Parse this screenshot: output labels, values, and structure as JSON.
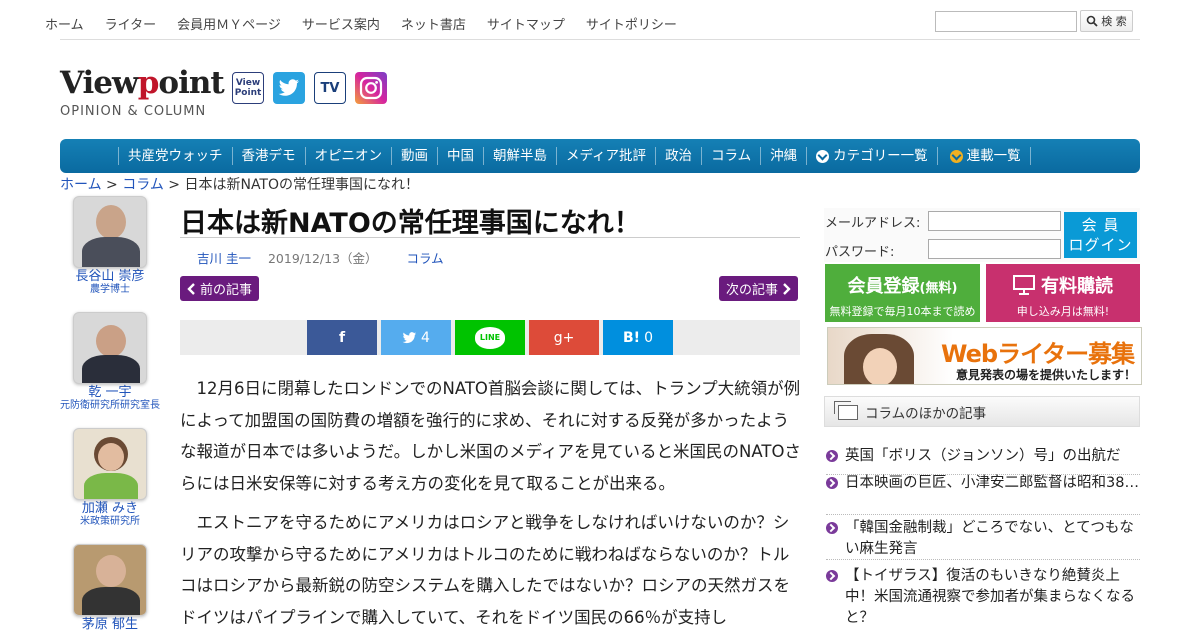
{
  "topnav": {
    "links": [
      "ホーム",
      "ライター",
      "会員用ＭＹページ",
      "サービス案内",
      "ネット書店",
      "サイトマップ",
      "サイトポリシー"
    ],
    "search_button": "検 索"
  },
  "logo": {
    "main_a": "View",
    "main_p": "p",
    "main_b": "oint",
    "sub": "OPINION & COLUMN"
  },
  "social": [
    {
      "name": "viewpoint-facebook",
      "label": "View Point",
      "color": "#2c3e7a"
    },
    {
      "name": "twitter",
      "label": "",
      "color": "#2aa3e0"
    },
    {
      "name": "tv-facebook",
      "label": "TV",
      "color": "#1a3f7a"
    },
    {
      "name": "instagram",
      "label": "",
      "color": "#c13584"
    }
  ],
  "catnav": {
    "items": [
      "共産党ウォッチ",
      "香港デモ",
      "オピニオン",
      "動画",
      "中国",
      "朝鮮半島",
      "メディア批評",
      "政治",
      "コラム",
      "沖縄"
    ],
    "category_list": "カテゴリー一覧",
    "series_list": "連載一覧"
  },
  "breadcrumb": {
    "home": "ホーム",
    "sep": ">",
    "section": "コラム",
    "current": "日本は新NATOの常任理事国になれ！"
  },
  "authors": [
    {
      "name": "長谷山 崇彦",
      "title": "農学博士"
    },
    {
      "name": "乾 一宇",
      "title": "元防衛研究所研究室長"
    },
    {
      "name": "加瀬 みき",
      "title": "米政策研究所"
    },
    {
      "name": "茅原 郁生",
      "title": ""
    }
  ],
  "article": {
    "title": "日本は新NATOの常任理事国になれ！",
    "author": "吉川 圭一",
    "date": "2019/12/13（金）",
    "category": "コラム",
    "prev": "前の記事",
    "next": "次の記事",
    "paragraphs": [
      "12月6日に閉幕したロンドンでのNATO首脳会談に関しては、トランプ大統領が例によって加盟国の国防費の増額を強行的に求め、それに対する反発が多かったような報道が日本では多いようだ。しかし米国のメディアを見ていると米国民のNATOさらには日米安保等に対する考え方の変化を見て取ることが出来る。",
      "エストニアを守るためにアメリカはロシアと戦争をしなければいけないのか？シリアの攻撃から守るためにアメリカはトルコのために戦わねばならないのか？トルコはロシアから最新鋭の防空システムを購入したではないか？ロシアの天然ガスをドイツはパイプラインで購入していて、それをドイツ国民の66％が支持し"
    ]
  },
  "share": {
    "facebook": "f",
    "twitter_count": "4",
    "line": "LINE",
    "gplus": "g+",
    "hatena": "B!",
    "hatena_count": "0",
    "colors": {
      "facebook": "#3b5998",
      "twitter": "#55acee",
      "line": "#00c300",
      "gplus": "#dd4b39",
      "hatena": "#008fde"
    }
  },
  "login": {
    "email_label": "メールアドレス:",
    "password_label": "パスワード:",
    "button_line1": "会 員",
    "button_line2": "ログイン"
  },
  "register": {
    "title": "会員登録",
    "title_sub": "(無料)",
    "note": "無料登録で毎月10本まで読める"
  },
  "purchase": {
    "title": "有料購読",
    "note": "申し込み月は無料!"
  },
  "banner": {
    "headline": "Webライター募集",
    "sub": "意見発表の場を提供いたします！"
  },
  "other": {
    "heading": "コラムのほかの記事",
    "items": [
      "英国「ボリス（ジョンソン）号」の出航だ",
      "日本映画の巨匠、小津安二郎監督は昭和38…",
      "「韓国金融制裁」どころでない、とてつもない麻生発言",
      "【トイザラス】復活のもいきなり絶賛炎上中！米国流通視察で参加者が集まらなくなると？"
    ]
  }
}
